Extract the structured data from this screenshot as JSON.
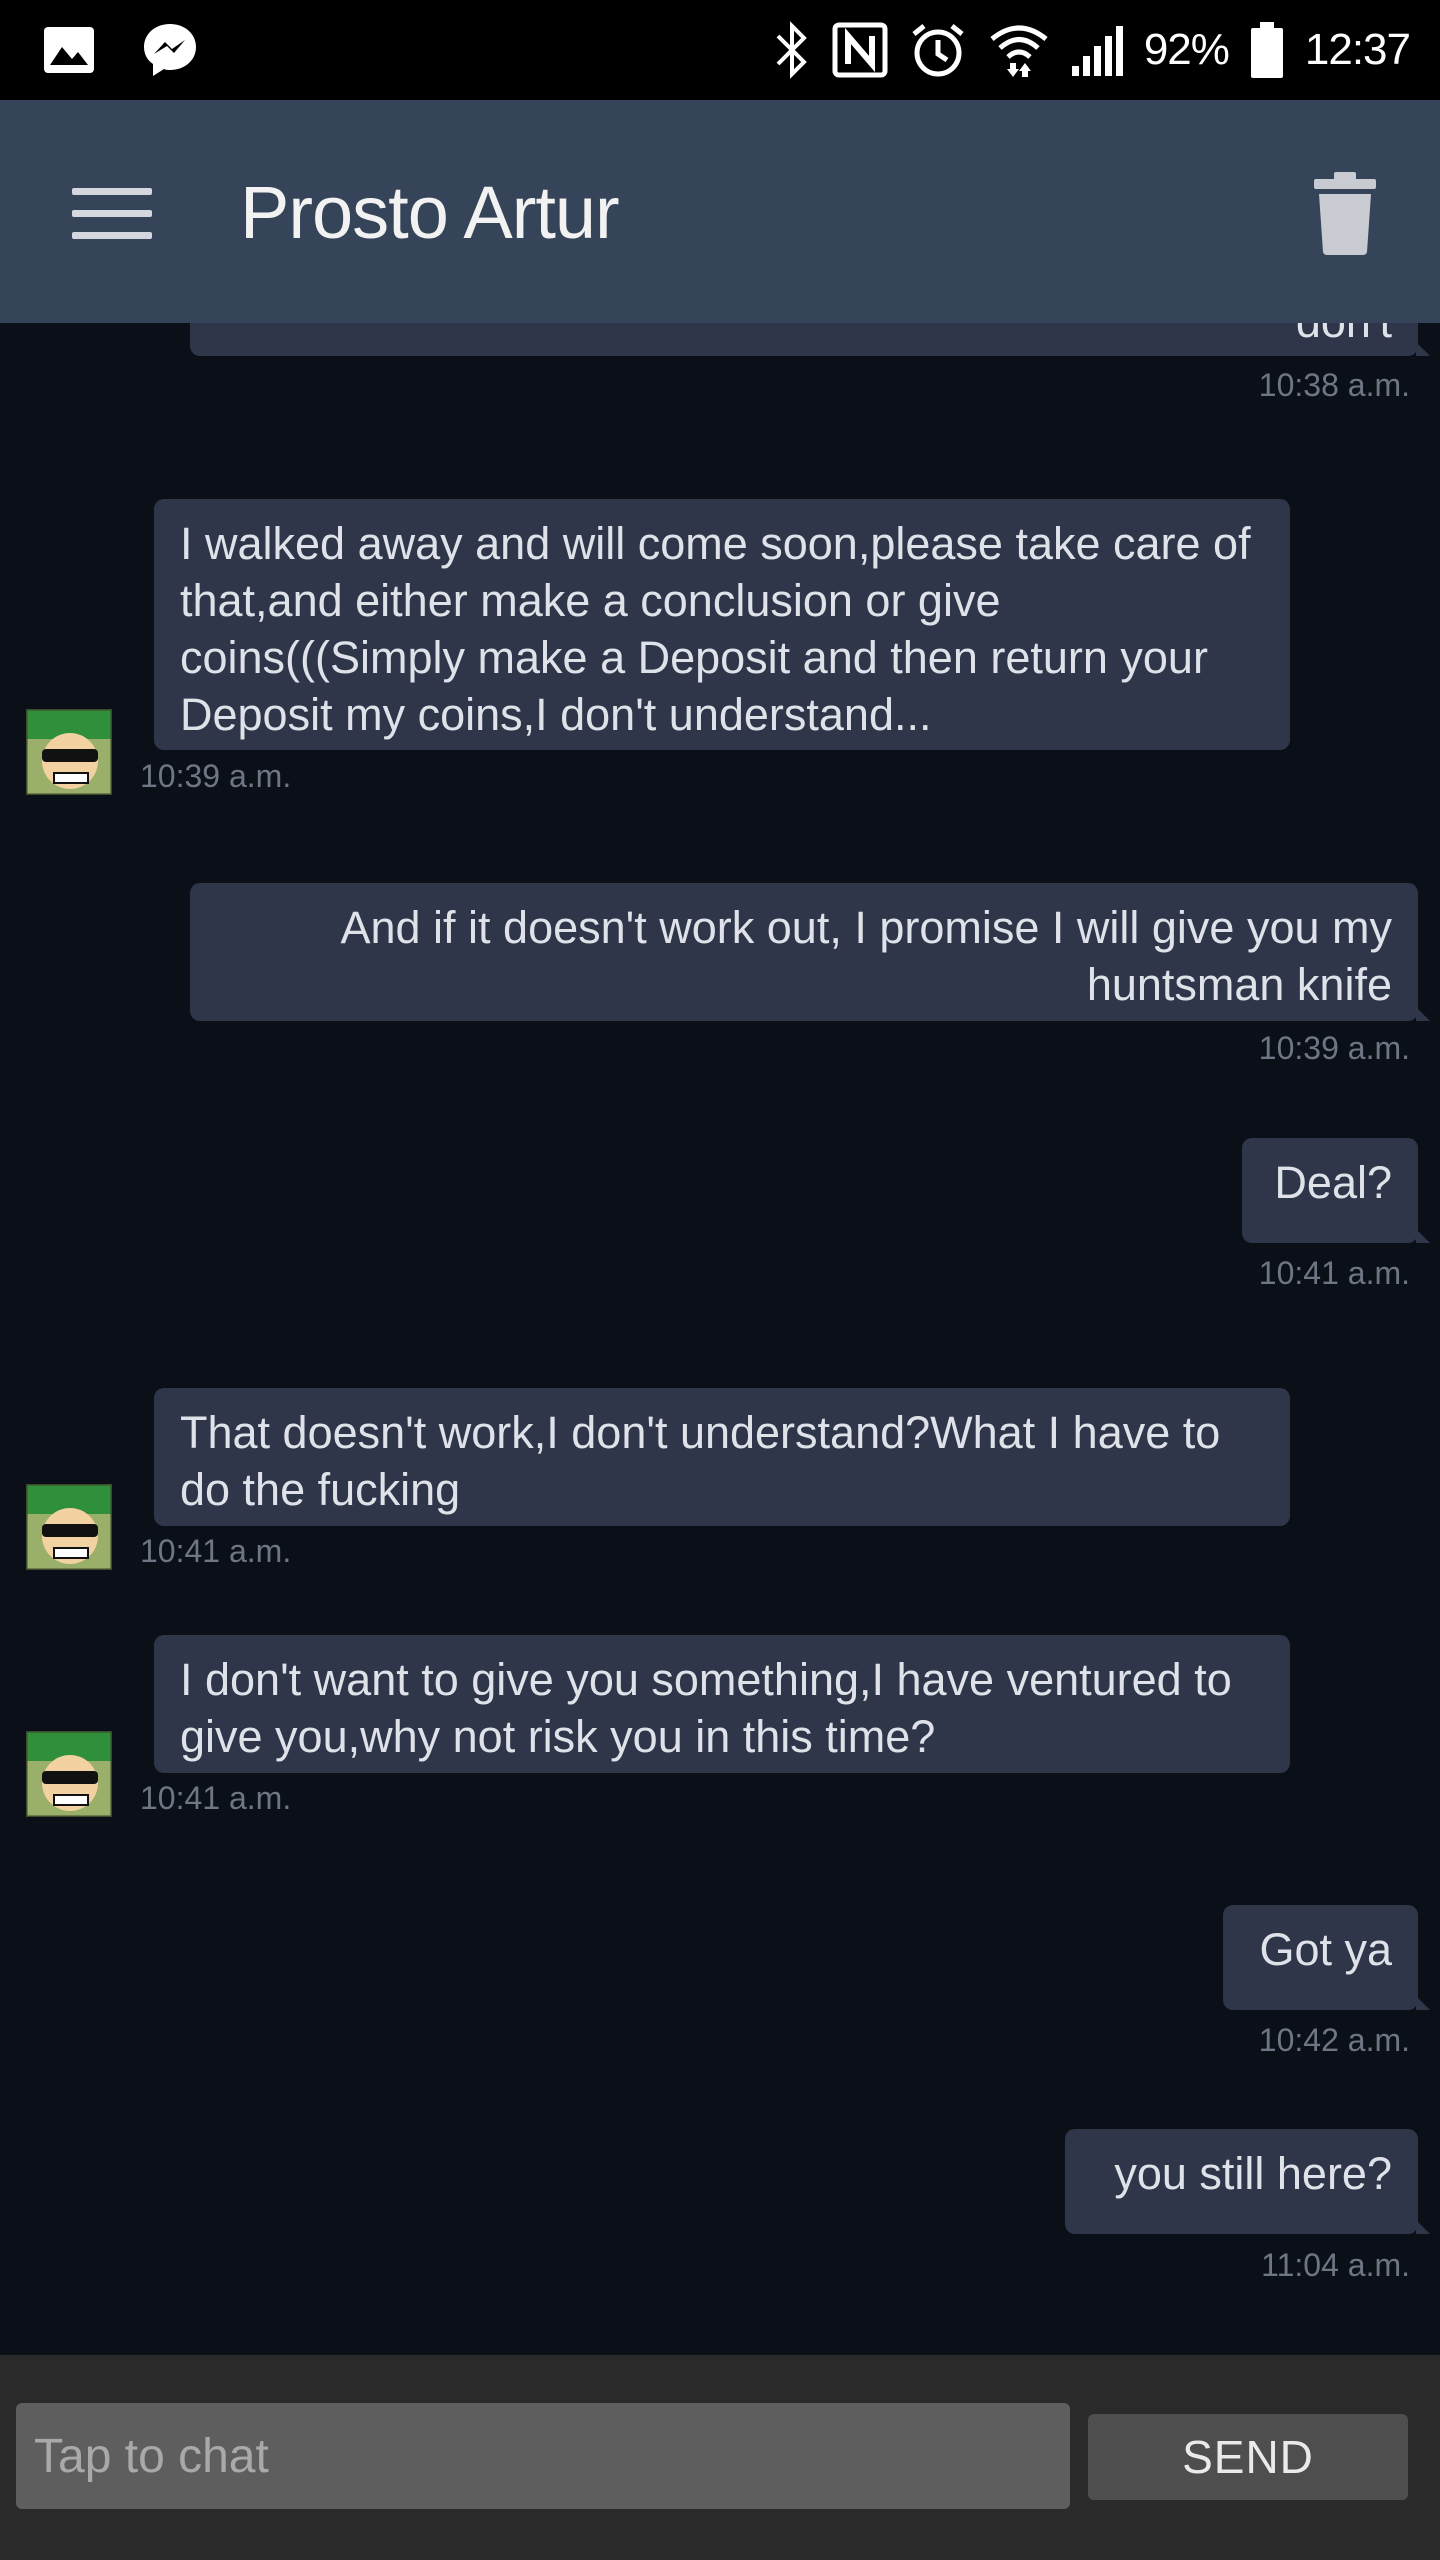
{
  "status_bar": {
    "battery": "92%",
    "time": "12:37",
    "icons": [
      "gallery-icon",
      "messenger-icon",
      "bluetooth-icon",
      "nfc-icon",
      "alarm-icon",
      "wifi-icon",
      "signal-icon",
      "battery-icon"
    ]
  },
  "header": {
    "title": "Prosto Artur",
    "menu_icon": "hamburger-menu-icon",
    "delete_icon": "trash-icon"
  },
  "messages": [
    {
      "direction": "out",
      "text": "don't",
      "time": "10:38 a.m."
    },
    {
      "direction": "in",
      "text": "I walked away and will come soon,please take care of that,and either make a conclusion or give coins(((Simply make a Deposit and then return your Deposit my coins,I don't understand...",
      "time": "10:39 a.m."
    },
    {
      "direction": "out",
      "text": "And if it doesn't work out, I promise I will give you my huntsman knife",
      "time": "10:39 a.m."
    },
    {
      "direction": "out",
      "text": "Deal?",
      "time": "10:41 a.m."
    },
    {
      "direction": "in",
      "text": "That doesn't work,I don't understand?What I have to do the fucking",
      "time": "10:41 a.m."
    },
    {
      "direction": "in",
      "text": "I don't want to give you something,I have ventured to give you,why not risk you in this time?",
      "time": "10:41 a.m."
    },
    {
      "direction": "out",
      "text": "Got ya",
      "time": "10:42 a.m."
    },
    {
      "direction": "out",
      "text": "you still here?",
      "time": "11:04 a.m."
    }
  ],
  "input": {
    "placeholder": "Tap to chat",
    "send_label": "SEND"
  },
  "colors": {
    "background": "#0b1018",
    "header": "#364459",
    "bubble": "#2f3649",
    "timestamp": "#6e7684",
    "input_bar": "#2a2a2a"
  }
}
